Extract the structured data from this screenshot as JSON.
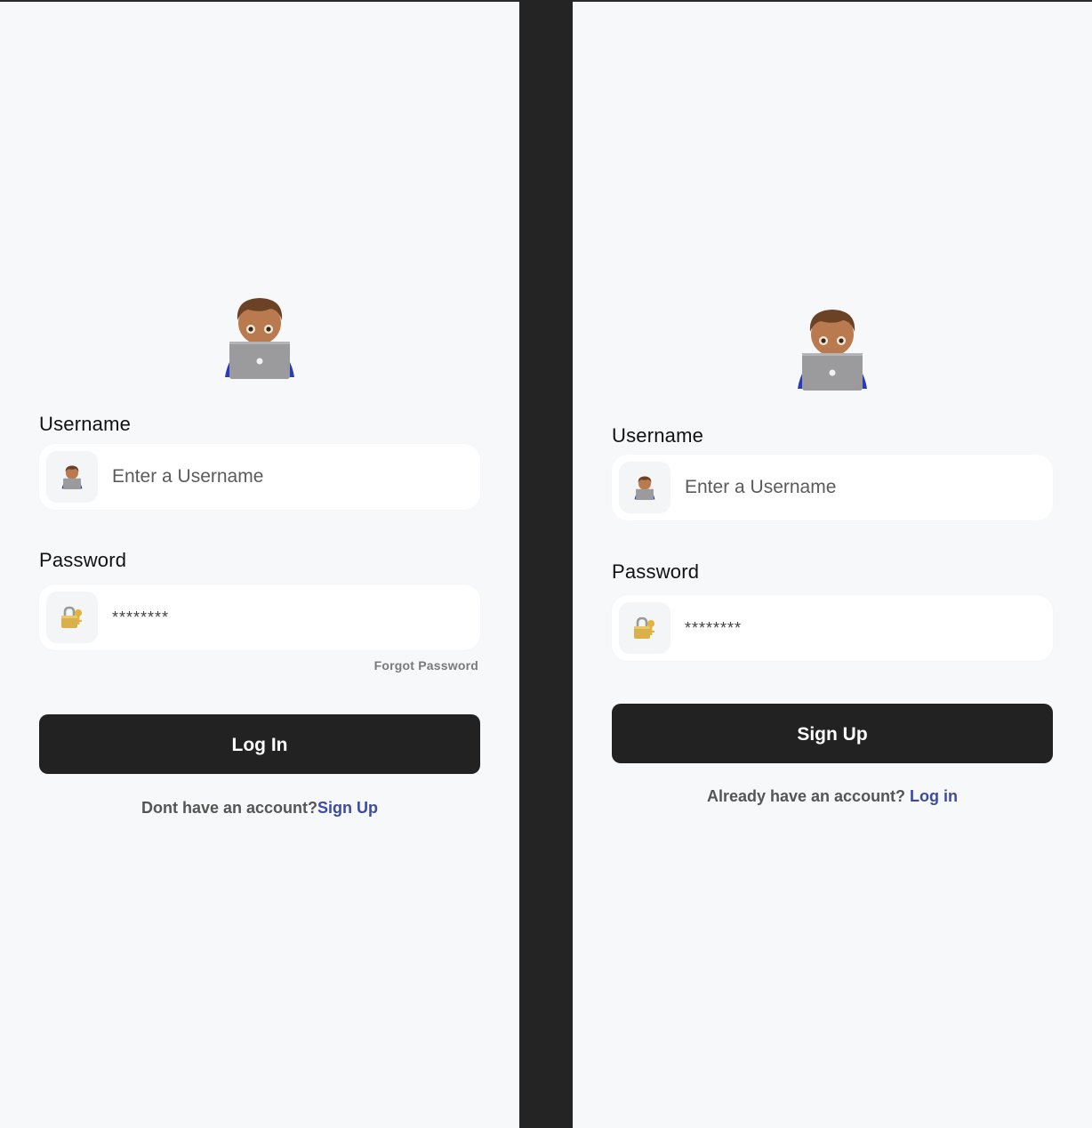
{
  "login": {
    "username_label": "Username",
    "username_placeholder": "Enter a Username",
    "password_label": "Password",
    "password_value": "********",
    "forgot_password": "Forgot Password",
    "submit_label": "Log In",
    "footer_prompt": "Dont have an account?",
    "footer_link": "Sign Up"
  },
  "signup": {
    "username_label": "Username",
    "username_placeholder": "Enter a Username",
    "password_label": "Password",
    "password_value": "********",
    "submit_label": "Sign Up",
    "footer_prompt": "Already have an account? ",
    "footer_link": "Log in"
  },
  "icons": {
    "avatar": "technologist-emoji-icon",
    "username_field": "technologist-emoji-icon",
    "password_field": "lock-with-key-icon"
  },
  "colors": {
    "panel_bg": "#f7f8fa",
    "divider": "#242424",
    "button_bg": "#222222",
    "link": "#3c4ba0"
  }
}
